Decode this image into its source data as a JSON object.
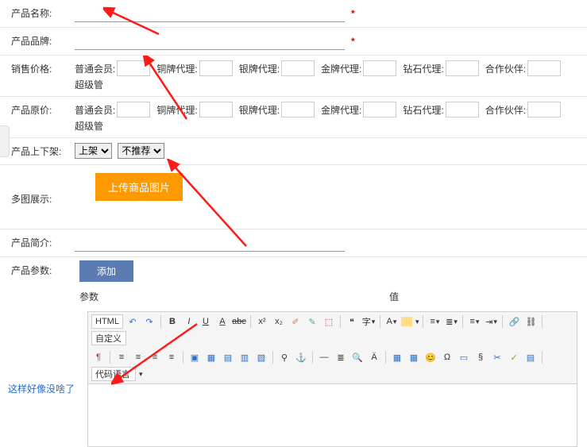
{
  "labels": {
    "product_name": "产品名称:",
    "product_brand": "产品品牌:",
    "sale_price": "销售价格:",
    "orig_price": "产品原价:",
    "shelf": "产品上下架:",
    "multi_img": "多图展示:",
    "summary": "产品简介:",
    "params": "产品参数:"
  },
  "required_mark": "*",
  "price_labels": {
    "normal": "普通会员:",
    "bronze": "铜牌代理:",
    "silver": "银牌代理:",
    "gold": "金牌代理:",
    "diamond": "钻石代理:",
    "partner": "合作伙伴:",
    "super": "超级管"
  },
  "selects": {
    "shelf_options": [
      "上架"
    ],
    "recommend_options": [
      "不推荐"
    ]
  },
  "buttons": {
    "upload": "上传商品图片",
    "add": "添加"
  },
  "param_header": {
    "param": "参数",
    "value": "值"
  },
  "editor": {
    "html": "HTML",
    "custom": "自定义",
    "codelang": "代码语言"
  },
  "footer_link": "这样好像没啥了",
  "colors": {
    "upload": "#ff9900",
    "add": "#5b7bb3"
  }
}
